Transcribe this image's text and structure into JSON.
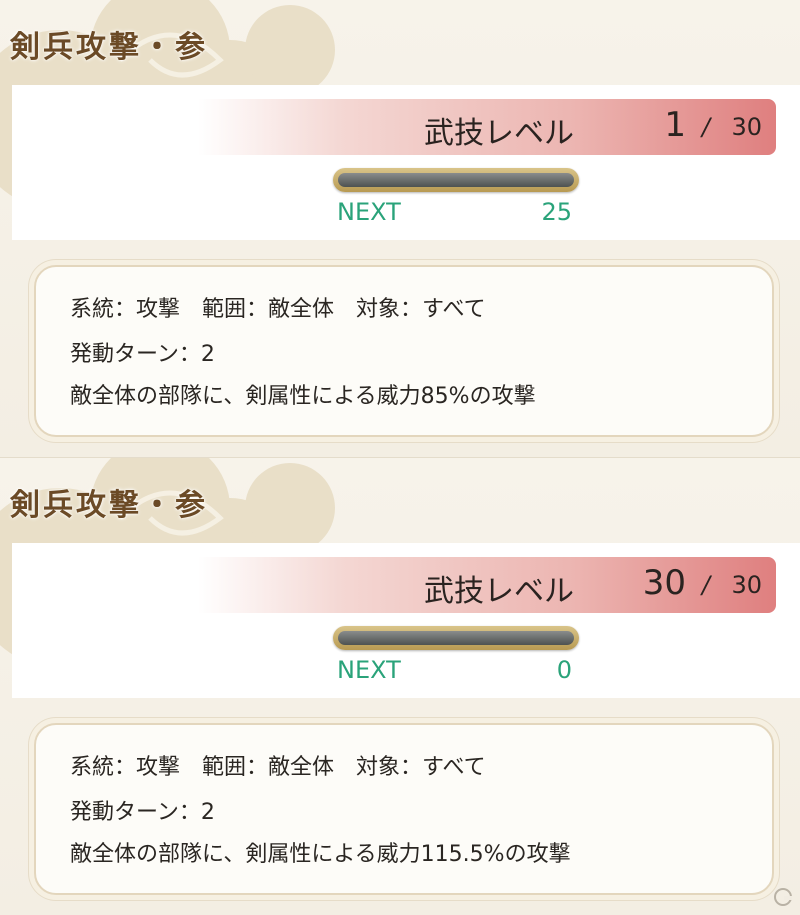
{
  "panels": [
    {
      "skill_name": "剣兵攻撃・参",
      "level_label": "武技レベル",
      "level_current": "1",
      "level_separator": "/",
      "level_max": "30",
      "next_label": "NEXT",
      "next_value": "25",
      "exp_progress": 0,
      "desc_lines": [
        "系統：攻撃　範囲：敵全体　対象：すべて",
        "発動ターン：2",
        "敵全体の部隊に、剣属性による威力85%の攻撃"
      ]
    },
    {
      "skill_name": "剣兵攻撃・参",
      "level_label": "武技レベル",
      "level_current": "30",
      "level_separator": "/",
      "level_max": "30",
      "next_label": "NEXT",
      "next_value": "0",
      "exp_progress": 0,
      "desc_lines": [
        "系統：攻撃　範囲：敵全体　対象：すべて",
        "発動ターン：2",
        "敵全体の部隊に、剣属性による威力115.5%の攻撃"
      ]
    }
  ],
  "colors": {
    "title": "#6b4a26",
    "next_text": "#2aa37a",
    "level_bar_end": "#df7f7f"
  },
  "icons": {
    "cloud": "cloud-decoration-icon",
    "watermark": "site-logo-icon"
  }
}
